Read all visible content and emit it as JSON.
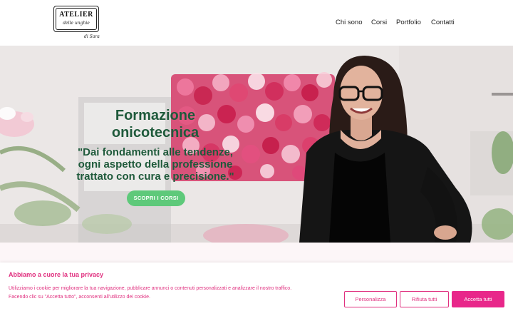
{
  "header": {
    "logo": {
      "title": "ATELIER",
      "subtitle": "delle unghie",
      "signature": "di Sara"
    },
    "nav": [
      {
        "label": "Chi sono"
      },
      {
        "label": "Corsi"
      },
      {
        "label": "Portfolio"
      },
      {
        "label": "Contatti"
      }
    ]
  },
  "hero": {
    "title_line1": "Formazione",
    "title_line2": "onicotecnica",
    "quote_line1": "\"Dai fondamenti alle tendenze,",
    "quote_line2": "ogni aspetto della professione",
    "quote_line3": "trattato con cura e precisione.\"",
    "cta_label": "SCOPRI I CORSI"
  },
  "cookie": {
    "title": "Abbiamo a cuore la tua privacy",
    "text_line1": "Utilizziamo i cookie per migliorare la tua navigazione, pubblicare annunci o contenuti personalizzati e analizzare il nostro traffico.",
    "text_line2": "Facendo clic su \"Accetta tutto\", acconsenti all'utilizzo dei cookie.",
    "buttons": {
      "customize": "Personalizza",
      "reject": "Rifiuta tutti",
      "accept": "Accetta tutti"
    }
  },
  "colors": {
    "accent_pink": "#e8278a",
    "hero_text_green": "#1f5a3b",
    "cta_green": "#5ec97a"
  }
}
